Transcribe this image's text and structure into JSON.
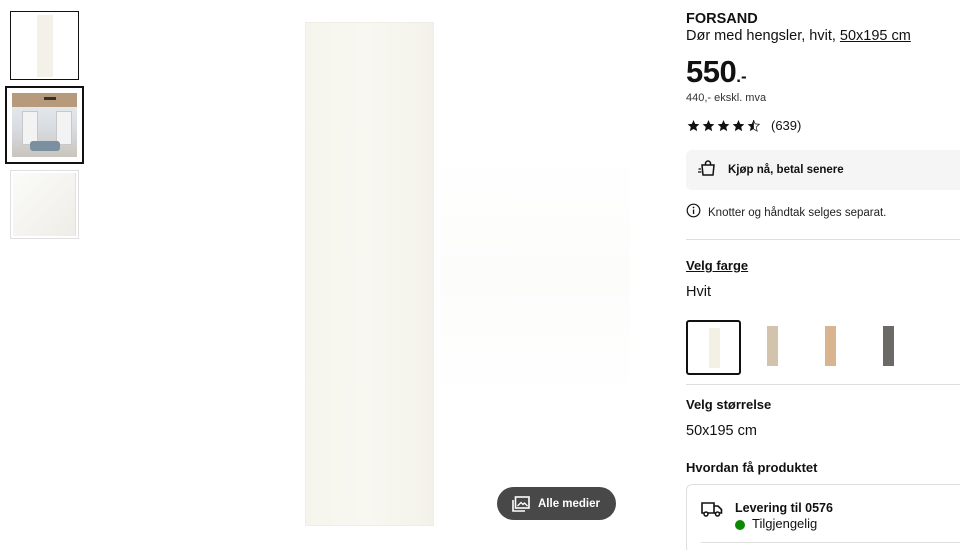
{
  "product": {
    "name": "FORSAND",
    "description": "Dør med hengsler, hvit, ",
    "size_link": "50x195 cm",
    "price_main": "550",
    "price_suffix": ".-",
    "price_ex_vat": "440,- ekskl. mva",
    "rating_value": 4.5,
    "rating_count": "(639)"
  },
  "gallery": {
    "thumbnails": [
      "door-front-image",
      "room-interior-image",
      "door-detail-image"
    ],
    "selected_index": 1,
    "media_button_label": "Alle medier"
  },
  "payment": {
    "label": "Kjøp nå, betal senere"
  },
  "notice": {
    "text": "Knotter og håndtak selges separat."
  },
  "color": {
    "heading": "Velg farge",
    "selected": "Hvit",
    "swatches": [
      {
        "color": "#f3f1e4",
        "selected": true
      },
      {
        "color": "#d1c3ac",
        "selected": false
      },
      {
        "color": "#d9b58f",
        "selected": false
      },
      {
        "color": "#6b6a66",
        "selected": false
      }
    ]
  },
  "size": {
    "heading": "Velg størrelse",
    "selected": "50x195 cm"
  },
  "shipping": {
    "heading": "Hvordan få produktet",
    "delivery_title": "Levering til 0576",
    "availability": "Tilgjengelig",
    "availability_color": "#0a8a00"
  },
  "icons": {
    "media": "image-gallery-icon",
    "klarna": "shopping-bag-icon",
    "info": "info-icon",
    "truck": "truck-icon",
    "star": "star-icon"
  }
}
